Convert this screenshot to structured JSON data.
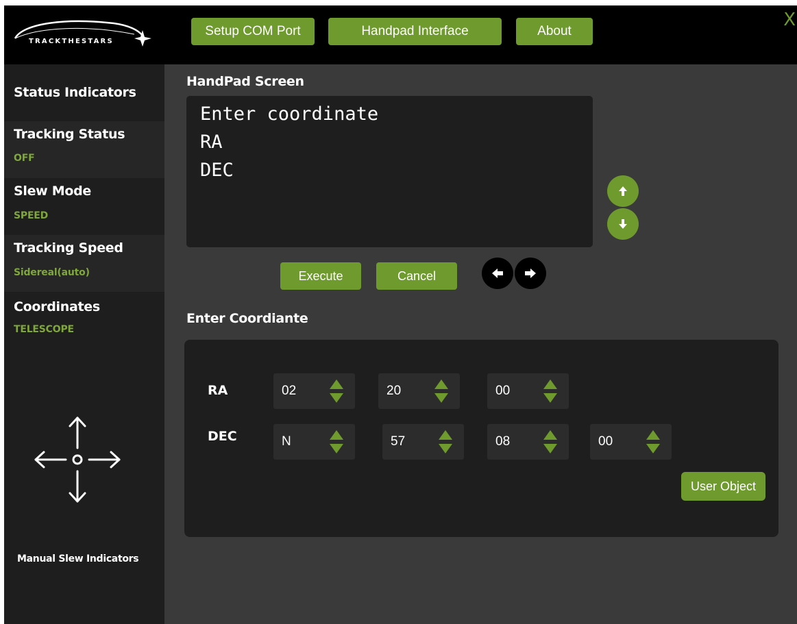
{
  "header": {
    "logo_text": "TRACKTHESTARS",
    "nav": [
      {
        "label": "Setup COM Port"
      },
      {
        "label": "Handpad Interface"
      },
      {
        "label": "About"
      }
    ],
    "close_label": "X"
  },
  "sidebar": {
    "status_title": "Status Indicators",
    "items": [
      {
        "title": "Tracking Status",
        "value": "OFF"
      },
      {
        "title": "Slew Mode",
        "value": "SPEED"
      },
      {
        "title": "Tracking Speed",
        "value": "Sidereal(auto)"
      },
      {
        "title": "Coordinates",
        "value": "TELESCOPE"
      }
    ],
    "footer": "Manual Slew Indicators"
  },
  "handpad": {
    "title": "HandPad Screen",
    "lines": [
      "Enter coordinate",
      "RA",
      "DEC"
    ],
    "execute_label": "Execute",
    "cancel_label": "Cancel"
  },
  "coordinates": {
    "title": "Enter Coordiante",
    "ra_label": "RA",
    "dec_label": "DEC",
    "ra": [
      "02",
      "20",
      "00"
    ],
    "dec": [
      "N",
      "57",
      "08",
      "00"
    ],
    "user_object_label": "User Object"
  },
  "colors": {
    "accent": "#6e9a2e",
    "status_value": "#7fa83a",
    "panel": "#1e1e1e",
    "background": "#3a3a3a"
  }
}
